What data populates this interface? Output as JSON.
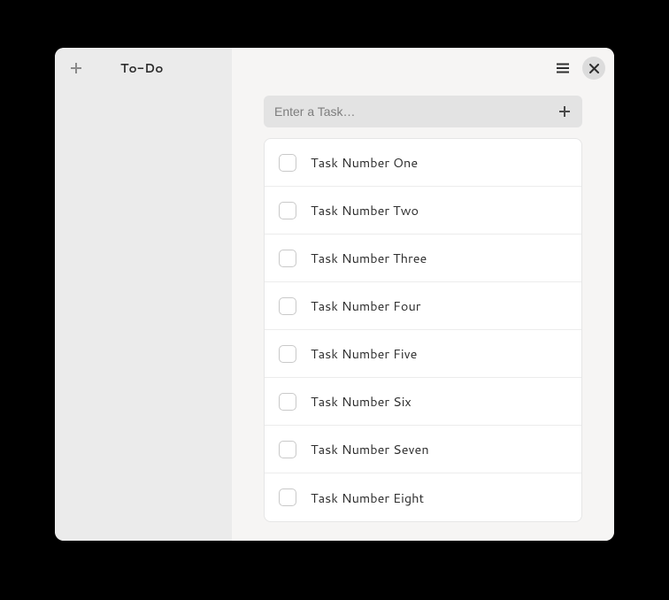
{
  "sidebar": {
    "title": "To-Do"
  },
  "entry": {
    "placeholder": "Enter a Task…"
  },
  "tasks": [
    {
      "label": "Task Number One"
    },
    {
      "label": "Task Number Two"
    },
    {
      "label": "Task Number Three"
    },
    {
      "label": "Task Number Four"
    },
    {
      "label": "Task Number Five"
    },
    {
      "label": "Task Number Six"
    },
    {
      "label": "Task Number Seven"
    },
    {
      "label": "Task Number Eight"
    }
  ]
}
